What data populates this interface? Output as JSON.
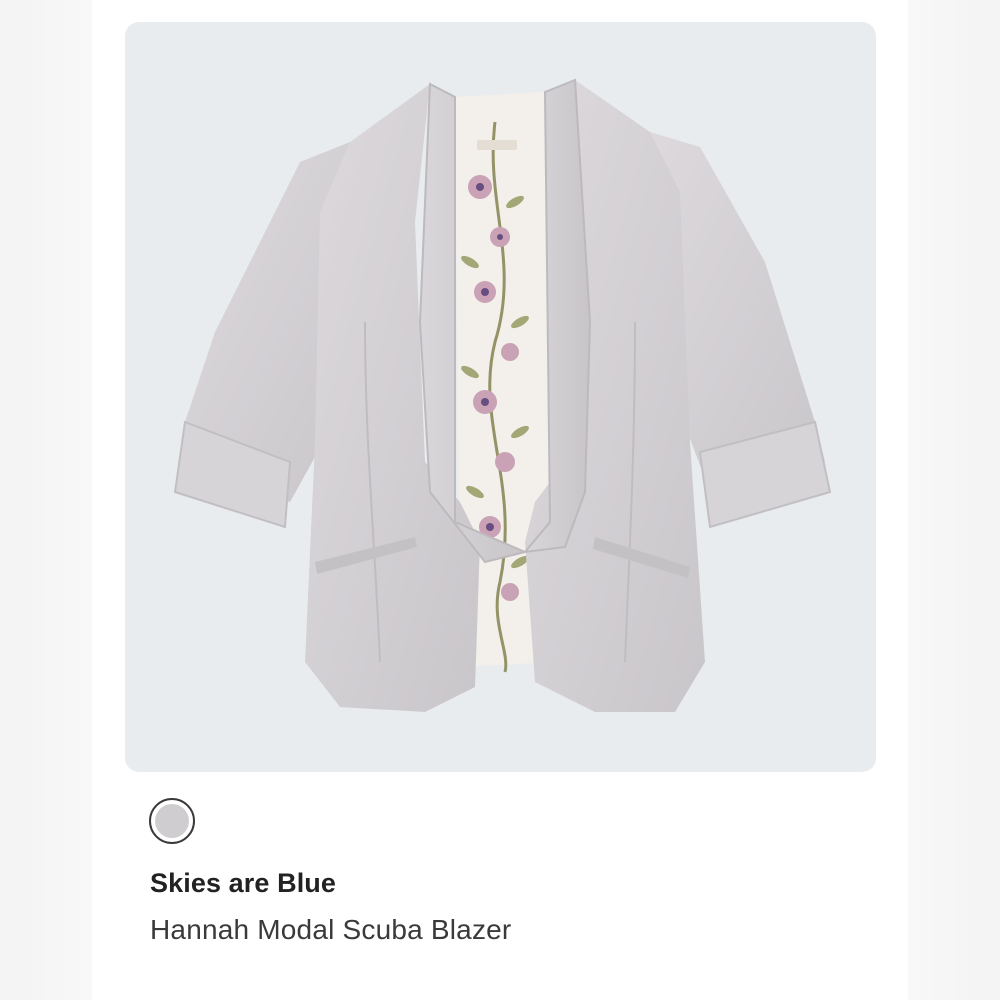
{
  "product": {
    "brand": "Skies are Blue",
    "name": "Hannah Modal Scuba Blazer",
    "image": "light gray open-front blazer with floral lining",
    "swatch_color": "#cfcdd0"
  },
  "actions": {
    "more_icon": "more-horizontal-icon"
  },
  "colors": {
    "page_background": "#f5f5f6",
    "card_background": "#e9ecee",
    "menu_dots": "#1c2a52",
    "brand_text": "#222222",
    "name_text": "#3a3a3a"
  }
}
